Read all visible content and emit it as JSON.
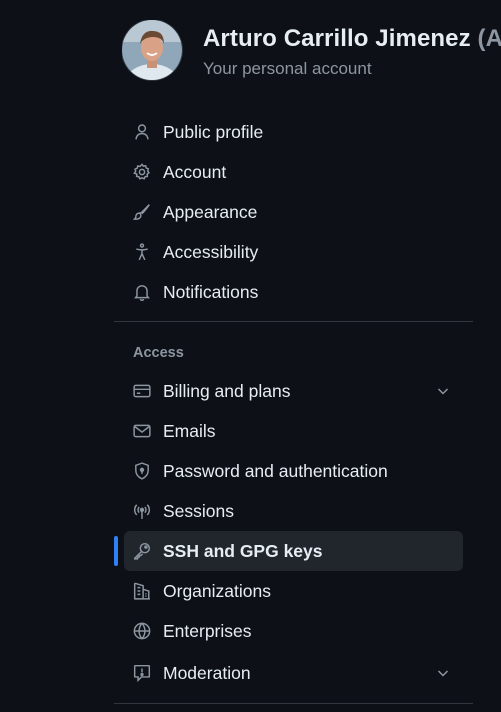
{
  "profile": {
    "name": "Arturo Carrillo Jimenez",
    "handle": "(Ar",
    "subtitle": "Your personal account"
  },
  "nav": {
    "top_items": [
      {
        "label": "Public profile",
        "icon": "person-icon"
      },
      {
        "label": "Account",
        "icon": "gear-icon"
      },
      {
        "label": "Appearance",
        "icon": "paintbrush-icon"
      },
      {
        "label": "Accessibility",
        "icon": "accessibility-icon"
      },
      {
        "label": "Notifications",
        "icon": "bell-icon"
      }
    ],
    "access_heading": "Access",
    "access_items": [
      {
        "label": "Billing and plans",
        "icon": "credit-card-icon",
        "expandable": true
      },
      {
        "label": "Emails",
        "icon": "mail-icon"
      },
      {
        "label": "Password and authentication",
        "icon": "shield-lock-icon"
      },
      {
        "label": "Sessions",
        "icon": "broadcast-icon"
      },
      {
        "label": "SSH and GPG keys",
        "icon": "key-icon",
        "selected": true
      },
      {
        "label": "Organizations",
        "icon": "organization-icon"
      },
      {
        "label": "Enterprises",
        "icon": "globe-icon"
      },
      {
        "label": "Moderation",
        "icon": "report-icon",
        "expandable": true
      }
    ]
  },
  "colors": {
    "background": "#0d1117",
    "text": "#e6edf3",
    "muted": "#8d96a0",
    "selected_bg": "#21262d",
    "accent": "#2f81f7",
    "border": "#30363d"
  }
}
